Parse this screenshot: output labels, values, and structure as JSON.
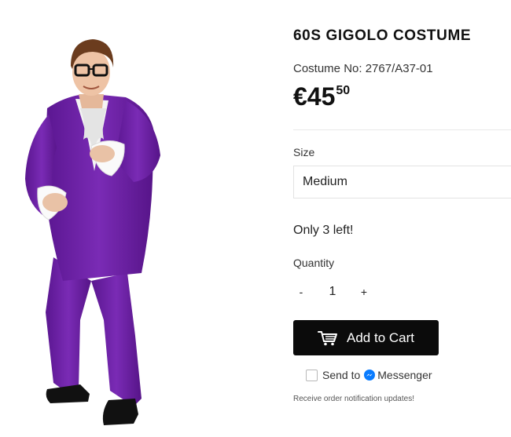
{
  "product": {
    "title": "60S GIGOLO COSTUME",
    "sku_text": "Costume No: 2767/A37-01",
    "price": {
      "currency": "€",
      "whole": "45",
      "cents": "50"
    },
    "stock_text": "Only 3 left!"
  },
  "size": {
    "label": "Size",
    "selected": "Medium"
  },
  "quantity": {
    "label": "Quantity",
    "minus": "-",
    "value": "1",
    "plus": "+"
  },
  "cart": {
    "button_label": "Add to Cart",
    "icon": "cart-icon"
  },
  "messenger": {
    "send_to": "Send to",
    "brand": "Messenger",
    "icon": "messenger-icon",
    "note": "Receive order notification updates!"
  },
  "colors": {
    "suit_purple": "#6b1fa3",
    "button_black": "#0b0b0b",
    "messenger_blue": "#0a7cff"
  }
}
